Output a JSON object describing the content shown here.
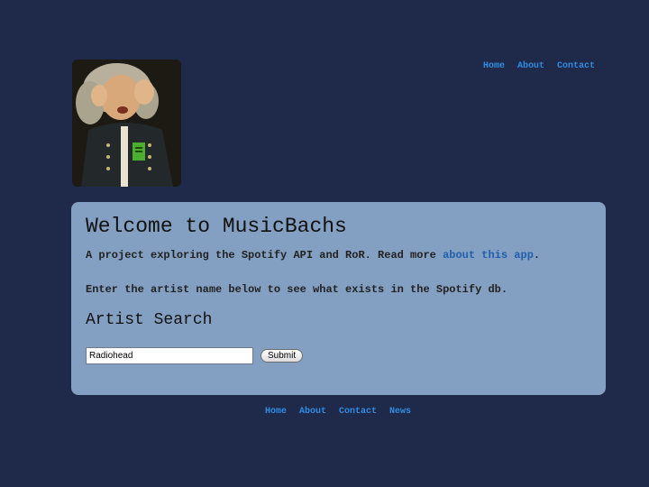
{
  "header": {
    "logo_name": "bach-portrait-logo",
    "nav": [
      {
        "label": "Home"
      },
      {
        "label": "About"
      },
      {
        "label": "Contact"
      }
    ]
  },
  "main": {
    "title": "Welcome to MusicBachs",
    "intro_text": "A project exploring the Spotify API and RoR. Read more ",
    "intro_link": "about this app",
    "intro_end": ".",
    "instructions": "Enter the artist name below to see what exists in the Spotify db.",
    "search_heading": "Artist Search",
    "search_value": "Radiohead",
    "submit_label": "Submit"
  },
  "footer": {
    "nav": [
      {
        "label": "Home"
      },
      {
        "label": "About"
      },
      {
        "label": "Contact"
      },
      {
        "label": "News"
      }
    ]
  },
  "colors": {
    "background": "#1f2949",
    "panel": "#839fc1",
    "link": "#2f8de4",
    "inline_link": "#1f5fae"
  }
}
